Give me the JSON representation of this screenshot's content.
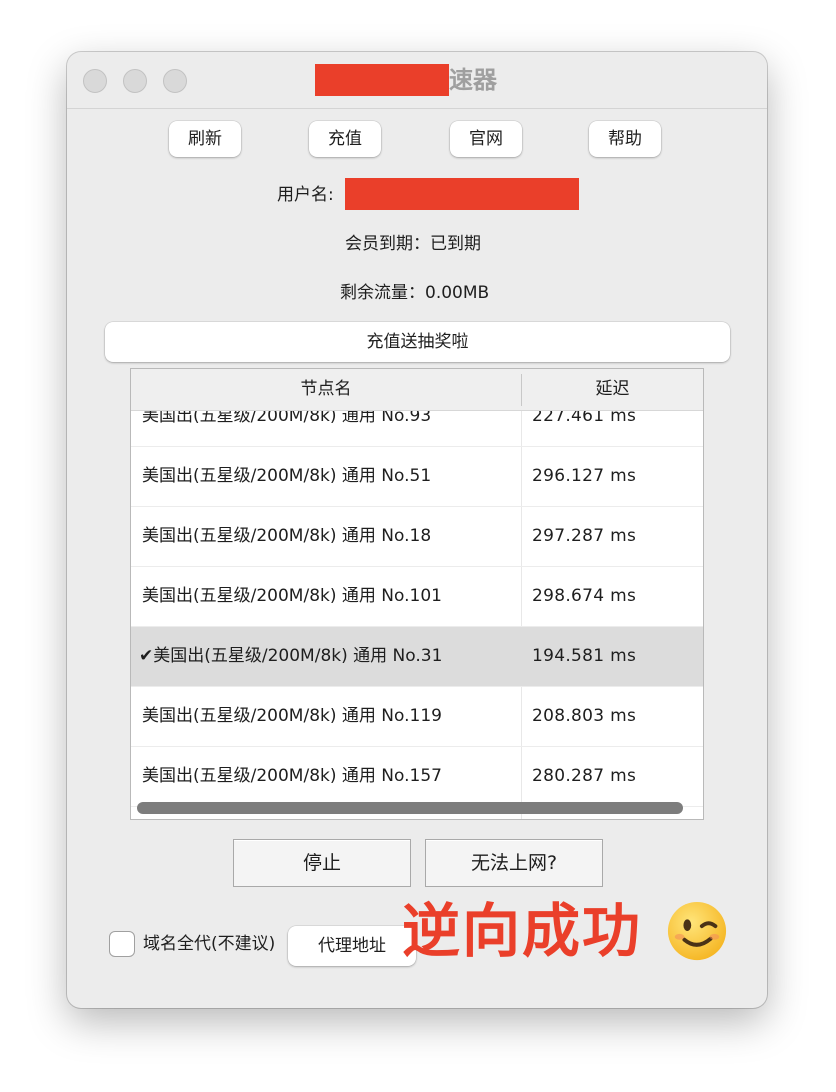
{
  "window": {
    "title_suffix": "速器"
  },
  "toolbar": {
    "refresh": "刷新",
    "recharge": "充值",
    "website": "官网",
    "help": "帮助"
  },
  "account": {
    "username_label": "用户名:",
    "membership": "会员到期：已到期",
    "traffic": "剩余流量：0.00MB"
  },
  "promo_button": "充值送抽奖啦",
  "node_table": {
    "columns": [
      "节点名",
      "延迟"
    ],
    "rows": [
      {
        "name": "美国出(五星级/200M/8k) 通用 No.93",
        "latency": "227.461 ms",
        "selected": false
      },
      {
        "name": "美国出(五星级/200M/8k) 通用 No.51",
        "latency": "296.127 ms",
        "selected": false
      },
      {
        "name": "美国出(五星级/200M/8k) 通用 No.18",
        "latency": "297.287 ms",
        "selected": false
      },
      {
        "name": "美国出(五星级/200M/8k) 通用 No.101",
        "latency": "298.674 ms",
        "selected": false
      },
      {
        "name": "✔美国出(五星级/200M/8k) 通用 No.31",
        "latency": "194.581 ms",
        "selected": true
      },
      {
        "name": "美国出(五星级/200M/8k) 通用 No.119",
        "latency": "208.803 ms",
        "selected": false
      },
      {
        "name": "美国出(五星级/200M/8k) 通用 No.157",
        "latency": "280.287 ms",
        "selected": false
      }
    ]
  },
  "actions": {
    "stop": "停止",
    "cannot_connect": "无法上网?"
  },
  "options": {
    "global_domain_label": "域名全代(不建议)",
    "global_domain_checked": false,
    "proxy_address_button": "代理地址"
  },
  "overlay": {
    "caption": "逆向成功",
    "emoji_icon": "winking-face-emoji",
    "accent_color": "#ea3f2a"
  }
}
